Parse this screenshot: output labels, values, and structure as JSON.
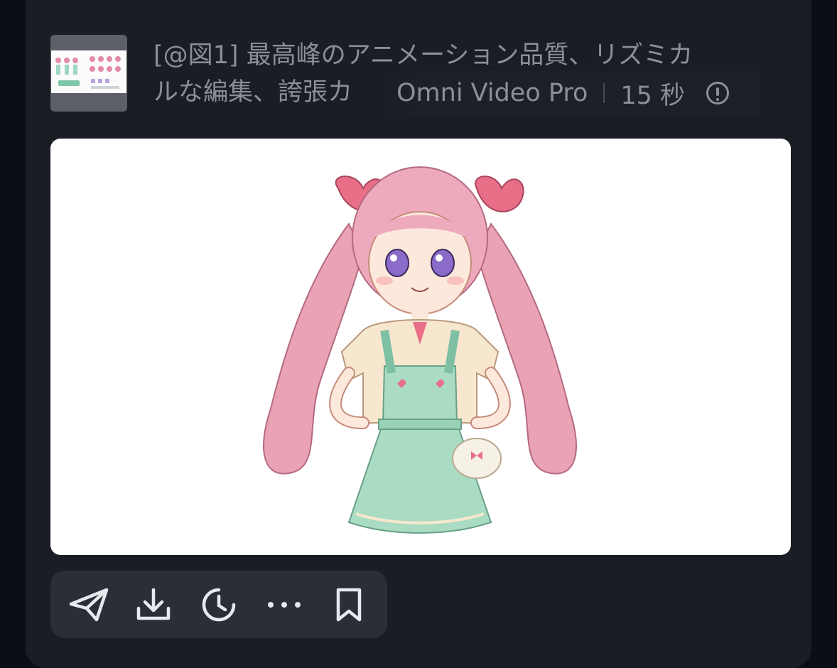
{
  "item": {
    "prompt_line1": "[@図1] 最高峰のアニメーション品質、リズミカ",
    "prompt_line2": "ルな編集、誇張カ",
    "model": "Omni Video Pro",
    "duration": "15 秒"
  },
  "icons": {
    "thumbnail": "reference-sheet-thumbnail",
    "info": "info-icon",
    "preview": "anime-girl-pink-twintails-image"
  },
  "toolbar": {
    "items": [
      "send-icon",
      "download-icon",
      "history-icon",
      "more-icon",
      "bookmark-icon"
    ]
  },
  "colors": {
    "background": "#0b0f15",
    "card": "#1a1d24",
    "toolbar": "#2b2e37",
    "text": "#8b8f98"
  }
}
